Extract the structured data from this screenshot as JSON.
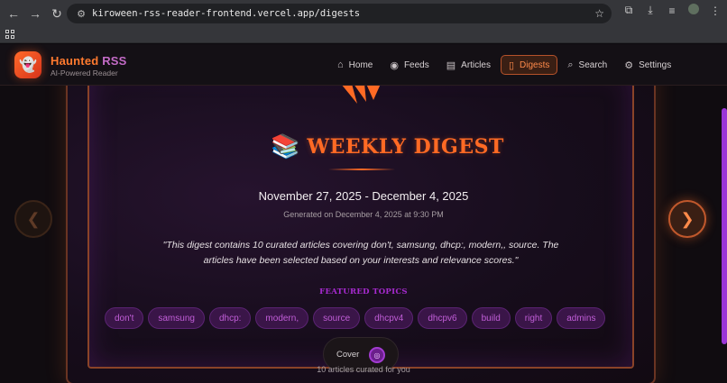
{
  "browser": {
    "url": "kiroween-rss-reader-frontend.vercel.app/digests",
    "icons": [
      "back-icon",
      "forward-icon",
      "reload-icon",
      "site-settings-icon",
      "bookmark-star-icon",
      "extensions-icon",
      "download-icon",
      "media-icon",
      "profile-avatar",
      "menu-icon",
      "apps-icon"
    ]
  },
  "app": {
    "brand_title_main": "Haunted ",
    "brand_title_tail": "RSS",
    "brand_subtitle": "AI-Powered Reader",
    "logo_icon": "ghost-icon",
    "nav": [
      {
        "label": "Home",
        "icon": "home-icon",
        "active": false
      },
      {
        "label": "Feeds",
        "icon": "rss-icon",
        "active": false
      },
      {
        "label": "Articles",
        "icon": "articles-icon",
        "active": false
      },
      {
        "label": "Digests",
        "icon": "book-open-icon",
        "active": true
      },
      {
        "label": "Search",
        "icon": "search-icon",
        "active": false
      },
      {
        "label": "Settings",
        "icon": "gear-icon",
        "active": false
      }
    ]
  },
  "digest": {
    "title": "WEEKLY DIGEST",
    "title_icon": "books-emoji",
    "date_range": "November 27, 2025 - December 4, 2025",
    "generated": "Generated on December 4, 2025 at 9:30 PM",
    "summary": "\"This digest contains 10 curated articles covering don't, samsung, dhcp:, modern,, source. The articles have been selected based on your interests and relevance scores.\"",
    "featured_label": "FEATURED TOPICS",
    "tags": [
      "don't",
      "samsung",
      "dhcp:",
      "modern,",
      "source",
      "dhcpv4",
      "dhcpv6",
      "build",
      "right",
      "admins"
    ],
    "cover_label": "Cover",
    "count_text": "10 articles curated for you"
  },
  "colors": {
    "accent_orange": "#ff6a24",
    "accent_purple": "#a72ad0",
    "tag_bg": "#3a1548",
    "background": "#100c10"
  }
}
